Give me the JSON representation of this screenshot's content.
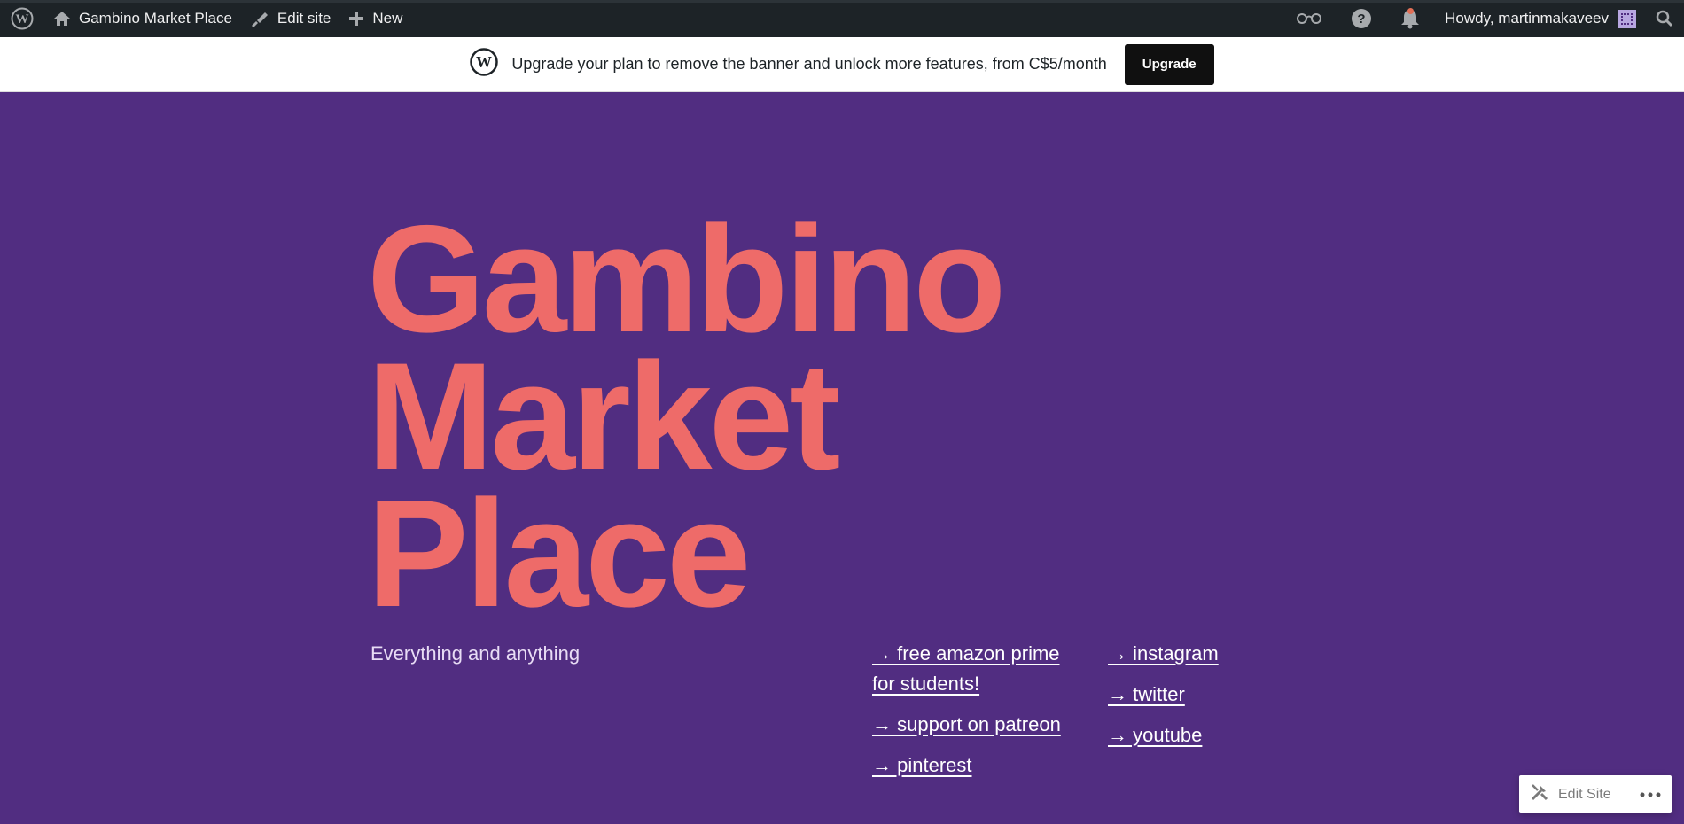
{
  "adminbar": {
    "site_name": "Gambino Market Place",
    "edit_site": "Edit site",
    "new": "New",
    "howdy": "Howdy, martinmakaveev",
    "icons": [
      "wordpress-icon",
      "home-icon",
      "brush-icon",
      "plus-icon",
      "reader-glasses-icon",
      "help-icon",
      "bell-icon",
      "avatar",
      "search-icon"
    ]
  },
  "banner": {
    "message": "Upgrade your plan to remove the banner and unlock more features, from C$5/month",
    "button": "Upgrade"
  },
  "hero": {
    "title_lines": [
      "Gambino",
      "Market",
      "Place"
    ],
    "tagline": "Everything and anything"
  },
  "links": {
    "col1": [
      "→ free amazon prime for students!",
      "→ support on patreon",
      "→ pinterest"
    ],
    "col2": [
      "→ instagram",
      "→ twitter",
      "→ youtube"
    ]
  },
  "edit_site_widget": {
    "label": "Edit Site"
  },
  "colors": {
    "background": "#512d81",
    "title": "#ee6b69",
    "adminbar": "#1d2327",
    "notification_dot": "#e26f56"
  }
}
